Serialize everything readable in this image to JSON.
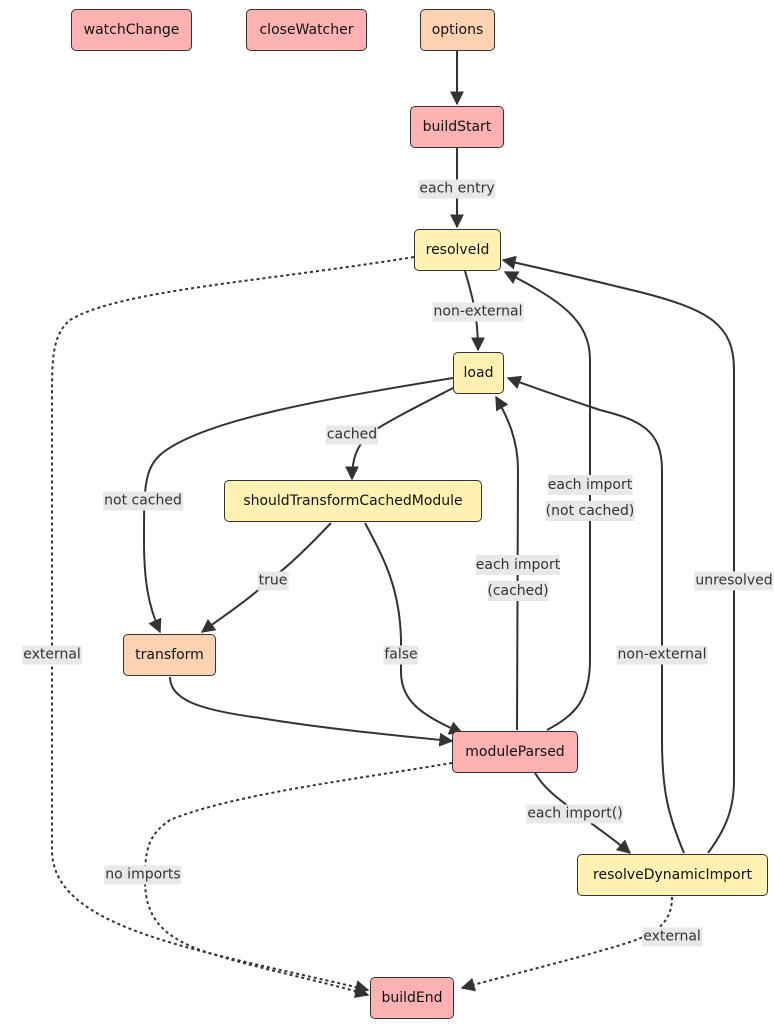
{
  "colors": {
    "hook_red": "#ffb2b2",
    "hook_orange": "#ffd2b2",
    "hook_yellow": "#fff2b2",
    "edge": "#333333",
    "label_bg": "#e8e8e8"
  },
  "nodes": {
    "watchChange": "watchChange",
    "closeWatcher": "closeWatcher",
    "options": "options",
    "buildStart": "buildStart",
    "resolveId": "resolveId",
    "load": "load",
    "shouldTransformCachedModule": "shouldTransformCachedModule",
    "transform": "transform",
    "moduleParsed": "moduleParsed",
    "resolveDynamicImport": "resolveDynamicImport",
    "buildEnd": "buildEnd"
  },
  "edges": [
    {
      "from": "options",
      "to": "buildStart",
      "label": "",
      "style": "solid"
    },
    {
      "from": "buildStart",
      "to": "resolveId",
      "label": "each entry",
      "style": "solid"
    },
    {
      "from": "resolveId",
      "to": "load",
      "label": "non-external",
      "style": "solid"
    },
    {
      "from": "resolveId",
      "to": "buildEnd",
      "label": "external",
      "style": "dotted"
    },
    {
      "from": "load",
      "to": "transform",
      "label": "not cached",
      "style": "solid"
    },
    {
      "from": "load",
      "to": "shouldTransformCachedModule",
      "label": "cached",
      "style": "solid"
    },
    {
      "from": "shouldTransformCachedModule",
      "to": "transform",
      "label": "true",
      "style": "solid"
    },
    {
      "from": "shouldTransformCachedModule",
      "to": "moduleParsed",
      "label": "false",
      "style": "solid"
    },
    {
      "from": "transform",
      "to": "moduleParsed",
      "label": "",
      "style": "solid"
    },
    {
      "from": "moduleParsed",
      "to": "load",
      "label": "each import (cached)",
      "style": "solid"
    },
    {
      "from": "moduleParsed",
      "to": "resolveId",
      "label": "each import (not cached)",
      "style": "solid"
    },
    {
      "from": "moduleParsed",
      "to": "resolveDynamicImport",
      "label": "each import()",
      "style": "solid"
    },
    {
      "from": "moduleParsed",
      "to": "buildEnd",
      "label": "no imports",
      "style": "dotted"
    },
    {
      "from": "resolveDynamicImport",
      "to": "load",
      "label": "non-external",
      "style": "solid"
    },
    {
      "from": "resolveDynamicImport",
      "to": "resolveId",
      "label": "unresolved",
      "style": "solid"
    },
    {
      "from": "resolveDynamicImport",
      "to": "buildEnd",
      "label": "external",
      "style": "dotted"
    }
  ],
  "labels": {
    "each_entry": "each entry",
    "non_external_1": "non-external",
    "external_1": "external",
    "not_cached": "not cached",
    "cached": "cached",
    "true": "true",
    "false": "false",
    "each_import_cached_1": "each import",
    "each_import_cached_2": "(cached)",
    "each_import_not_cached_1": "each import",
    "each_import_not_cached_2": "(not cached)",
    "non_external_2": "non-external",
    "unresolved": "unresolved",
    "each_import_dyn": "each import()",
    "no_imports": "no imports",
    "external_2": "external"
  }
}
